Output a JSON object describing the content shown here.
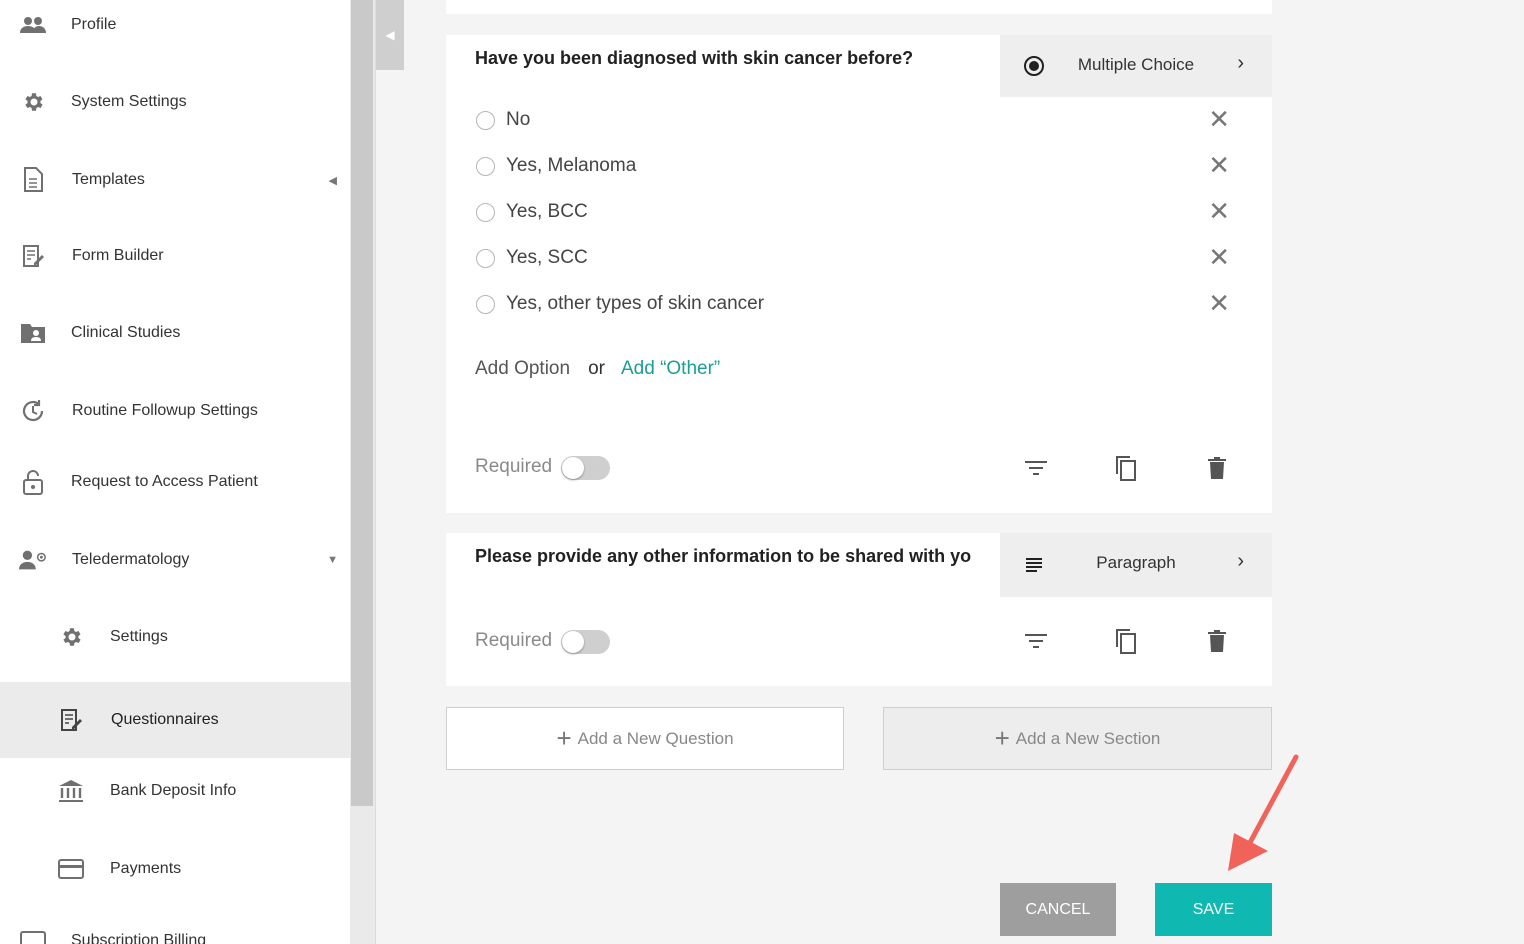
{
  "sidebar": {
    "items": [
      {
        "label": "Profile",
        "icon": "people-icon"
      },
      {
        "label": "System Settings",
        "icon": "gear-icon"
      },
      {
        "label": "Templates",
        "icon": "document-icon"
      },
      {
        "label": "Form Builder",
        "icon": "form-edit-icon"
      },
      {
        "label": "Clinical Studies",
        "icon": "folder-user-icon"
      },
      {
        "label": "Routine Followup Settings",
        "icon": "history-icon"
      },
      {
        "label": "Request to Access Patient",
        "icon": "lock-open-icon"
      },
      {
        "label": "Teledermatology",
        "icon": "doctor-icon"
      },
      {
        "label": "Settings",
        "icon": "gear-icon"
      },
      {
        "label": "Questionnaires",
        "icon": "form-edit-icon"
      },
      {
        "label": "Bank Deposit Info",
        "icon": "bank-icon"
      },
      {
        "label": "Payments",
        "icon": "credit-card-icon"
      },
      {
        "label": "Subscription Billing",
        "icon": "billing-icon"
      }
    ]
  },
  "question1": {
    "title": "Have you been diagnosed with skin cancer before?",
    "type_label": "Multiple Choice",
    "options": [
      "No",
      "Yes, Melanoma",
      "Yes, BCC",
      "Yes, SCC",
      "Yes, other types of skin cancer"
    ],
    "add_option": "Add Option",
    "or": "or",
    "add_other": "Add “Other”",
    "required_label": "Required",
    "required": false
  },
  "question2": {
    "title": "Please provide any other information to be shared with you",
    "type_label": "Paragraph",
    "required_label": "Required",
    "required": false
  },
  "actions": {
    "add_question": "Add a New Question",
    "add_section": "Add a New Section",
    "cancel": "CANCEL",
    "save": "SAVE"
  },
  "colors": {
    "accent": "#0fb9b1",
    "link": "#1a9e96",
    "cancel": "#9e9e9e",
    "arrow": "#f0635a"
  }
}
